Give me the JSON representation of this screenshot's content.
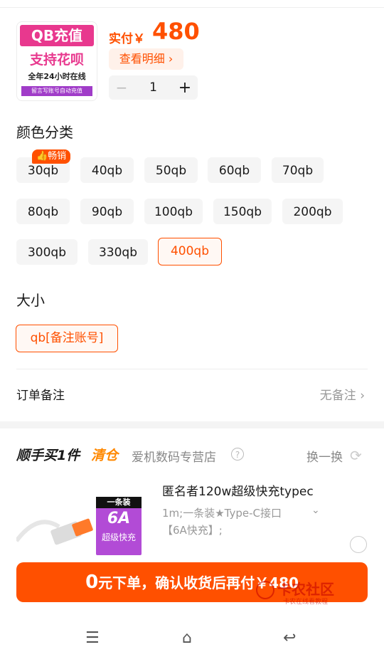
{
  "product": {
    "thumb_line1": "QB充值",
    "thumb_line2": "支持花呗",
    "thumb_line3": "全年24小时在线",
    "thumb_line4": "留言写账号自动充值",
    "price_label": "实付￥",
    "price_value": "480",
    "detail_button": "查看明细 ›",
    "quantity": "1",
    "minus": "−",
    "plus": "+"
  },
  "color_section": {
    "title": "颜色分类",
    "hot_badge": "👍畅销",
    "options": [
      "30qb",
      "40qb",
      "50qb",
      "60qb",
      "70qb",
      "80qb",
      "90qb",
      "100qb",
      "150qb",
      "200qb",
      "300qb",
      "330qb",
      "400qb"
    ],
    "selected": "400qb"
  },
  "size_section": {
    "title": "大小",
    "options": [
      "qb[备注账号]"
    ],
    "selected": "qb[备注账号]"
  },
  "remark": {
    "label": "订单备注",
    "value": "无备注 ›"
  },
  "addon": {
    "title": "顺手买1件",
    "tag": "清仓",
    "shop": "爱机数码专营店",
    "help_icon": "?",
    "swap_label": "换一换",
    "swap_icon": "refresh-icon",
    "box_line1": "一条装",
    "box_line2": "6A",
    "box_line3": "超级快充",
    "name": "匿名者120w超级快充typec",
    "spec": "1m;一条装★Type-C接口",
    "spec_chevron": "⌄",
    "spec2": "【6A快充】;"
  },
  "submit": {
    "big": "0",
    "text": "元下单，确认收货后再付￥480"
  },
  "watermark": {
    "line1": "卡农社区",
    "line2": "卡农在线看教程"
  },
  "navbar": {
    "menu_icon": "☰",
    "home_icon": "⌂",
    "back_icon": "↩"
  },
  "colors": {
    "accent": "#ff5000",
    "tag_orange": "#ff8800"
  }
}
